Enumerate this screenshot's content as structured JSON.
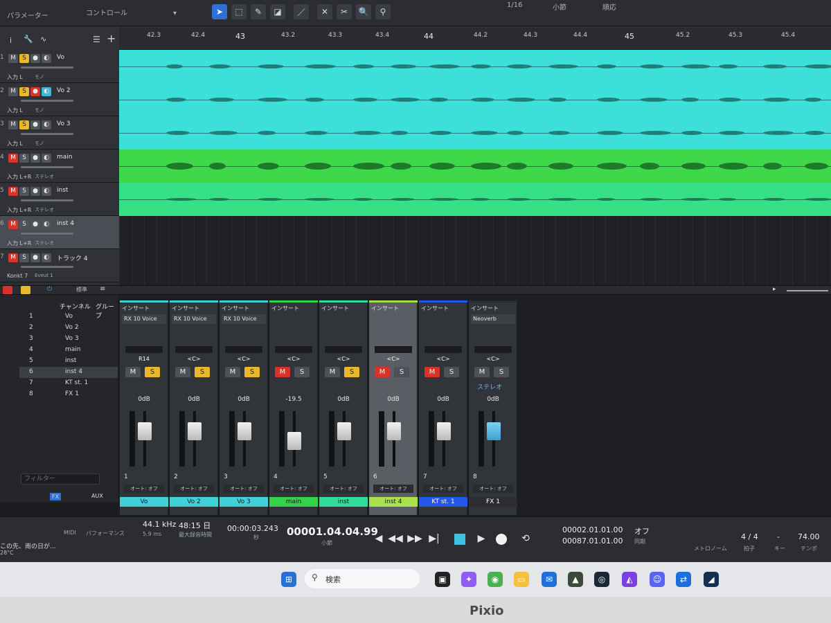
{
  "topbar": {
    "param_label": "パラメーター",
    "control_label": "コントロール",
    "quantize": "1/16",
    "timebase": "小節",
    "snap": "順応"
  },
  "ruler": {
    "marks": [
      "42.3",
      "42.4",
      "43",
      "43.2",
      "43.3",
      "43.4",
      "44",
      "44.2",
      "44.3",
      "44.4",
      "45",
      "45.2",
      "45.3",
      "45.4"
    ]
  },
  "tracks": [
    {
      "num": "1",
      "name": "Vo",
      "input": "入力 L",
      "mode": "モノ",
      "mute": false,
      "solo": true,
      "monitor": false
    },
    {
      "num": "2",
      "name": "Vo 2",
      "input": "入力 L",
      "mode": "モノ",
      "mute": false,
      "solo": true,
      "monitor": true
    },
    {
      "num": "3",
      "name": "Vo 3",
      "input": "入力 L",
      "mode": "モノ",
      "mute": false,
      "solo": true,
      "monitor": false
    },
    {
      "num": "4",
      "name": "main",
      "input": "入力 L+R",
      "mode": "ステレオ",
      "mute": true,
      "solo": false,
      "monitor": false
    },
    {
      "num": "5",
      "name": "inst",
      "input": "入力 L+R",
      "mode": "ステレオ",
      "mute": true,
      "solo": false,
      "monitor": false
    },
    {
      "num": "6",
      "name": "inst 4",
      "input": "入力 L+R",
      "mode": "ステレオ",
      "mute": true,
      "solo": false,
      "monitor": false
    },
    {
      "num": "7",
      "name": "トラック 4",
      "input": "Konkt 7",
      "mode": "Eveut 1",
      "mute": true,
      "solo": false,
      "monitor": false
    }
  ],
  "bottom_bar": {
    "preset": "標準"
  },
  "channel_list": {
    "header_channel": "チャンネル",
    "header_group": "グループ",
    "filter_placeholder": "フィルター",
    "rows": [
      {
        "num": "1",
        "name": "Vo"
      },
      {
        "num": "2",
        "name": "Vo 2"
      },
      {
        "num": "3",
        "name": "Vo 3"
      },
      {
        "num": "4",
        "name": "main"
      },
      {
        "num": "5",
        "name": "inst"
      },
      {
        "num": "6",
        "name": "inst 4"
      },
      {
        "num": "7",
        "name": "KT st. 1"
      },
      {
        "num": "8",
        "name": "FX 1"
      }
    ],
    "tabs": [
      "FX",
      "AUX"
    ]
  },
  "mixer": {
    "insert_label": "インサート",
    "auto_label": "オート: オフ",
    "strips": [
      {
        "num": "1",
        "name": "Vo",
        "plugin": "RX 10 Voice",
        "pan": "R14",
        "vol": "0dB",
        "mute": false,
        "solo": true,
        "color": "#3fd0d8",
        "fader": 0.3
      },
      {
        "num": "2",
        "name": "Vo 2",
        "plugin": "RX 10 Voice",
        "pan": "<C>",
        "vol": "0dB",
        "mute": false,
        "solo": true,
        "color": "#3fd0d8",
        "fader": 0.3
      },
      {
        "num": "3",
        "name": "Vo 3",
        "plugin": "RX 10 Voice",
        "pan": "<C>",
        "vol": "0dB",
        "mute": false,
        "solo": true,
        "color": "#3fd0d8",
        "fader": 0.3
      },
      {
        "num": "4",
        "name": "main",
        "plugin": "",
        "pan": "<C>",
        "vol": "-19.5",
        "mute": true,
        "solo": false,
        "color": "#34d14a",
        "fader": 0.55
      },
      {
        "num": "5",
        "name": "inst",
        "plugin": "",
        "pan": "<C>",
        "vol": "0dB",
        "mute": false,
        "solo": true,
        "color": "#2fdc9a",
        "fader": 0.3
      },
      {
        "num": "6",
        "name": "inst 4",
        "plugin": "",
        "pan": "<C>",
        "vol": "0dB",
        "mute": true,
        "solo": false,
        "color": "#a7e04a",
        "fader": 0.3
      },
      {
        "num": "7",
        "name": "KT st. 1",
        "plugin": "",
        "pan": "<C>",
        "vol": "0dB",
        "mute": true,
        "solo": false,
        "color": "#2456e8",
        "fader": 0.3
      },
      {
        "num": "8",
        "name": "FX 1",
        "plugin": "Neoverb",
        "pan": "<C>",
        "vol": "0dB",
        "mute": false,
        "solo": false,
        "color": "#2b2d31",
        "fader": 0.3,
        "extra": "ステレオ"
      }
    ]
  },
  "transport": {
    "midi": "MIDI",
    "performance": "パフォーマンス",
    "samplerate": "44.1 kHz",
    "latency": "5.9 ms",
    "rec_time": "48:15 日",
    "rec_time_label": "最大録音時間",
    "seconds": "00:00:03.243",
    "seconds_unit": "秒",
    "position": "00001.04.04.99",
    "position_unit": "小節",
    "loop_l": "00002.01.01.00",
    "loop_r": "00087.01.01.00",
    "sync": "オフ",
    "sync_label": "同期",
    "metronome_label": "メトロノーム",
    "signature": "4 / 4",
    "signature_label": "拍子",
    "key": "-",
    "key_label": "キー",
    "tempo": "74.00",
    "tempo_label": "テンポ"
  },
  "taskbar": {
    "weather_text": "この先、雨の日が...",
    "temp": "28°C",
    "search": "検索"
  },
  "monitor_brand": "Pixio"
}
